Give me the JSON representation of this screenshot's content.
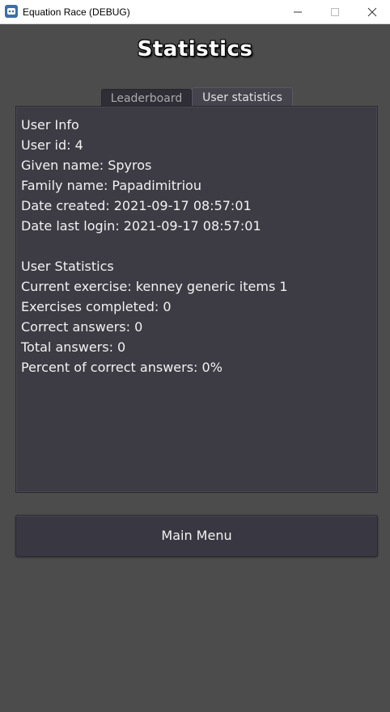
{
  "window": {
    "title": "Equation Race (DEBUG)",
    "icons": [
      "app-icon",
      "minimize-icon",
      "maximize-icon",
      "close-icon"
    ]
  },
  "page": {
    "title": "Statistics"
  },
  "tabs": [
    {
      "label": "Leaderboard",
      "active": false
    },
    {
      "label": "User statistics",
      "active": true
    }
  ],
  "user_info": {
    "heading": "User Info",
    "user_id": "User id: 4",
    "given_name": "Given name: Spyros",
    "family_name": "Family name: Papadimitriou",
    "date_created": "Date created: 2021-09-17 08:57:01",
    "date_last_login": "Date last login: 2021-09-17 08:57:01"
  },
  "user_statistics": {
    "heading": "User Statistics",
    "current_exercise": "Current exercise: kenney generic items 1",
    "exercises_completed": "Exercises completed: 0",
    "correct_answers": "Correct answers: 0",
    "total_answers": "Total answers: 0",
    "percent_correct": "Percent of correct answers: 0%"
  },
  "buttons": {
    "main_menu": "Main Menu"
  },
  "colors": {
    "background": "#4c4c4c",
    "panel": "#3d3c45",
    "text": "#f2f2f2"
  }
}
